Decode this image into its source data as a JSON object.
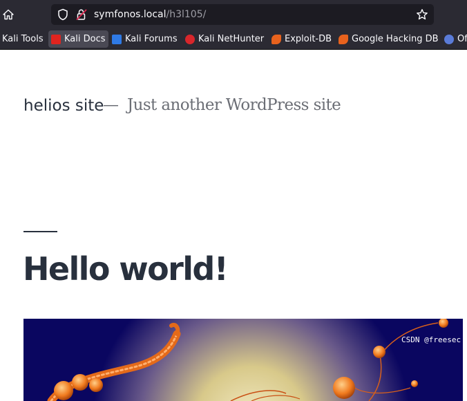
{
  "browser": {
    "url_host": "symfonos.local",
    "url_path": "/h3l105/",
    "icons": {
      "home": "home-icon",
      "shield": "shield-icon",
      "lock": "lock-strike-icon",
      "bookmark": "star-icon"
    }
  },
  "bookmarks": [
    {
      "label": "Kali Tools",
      "icon": ""
    },
    {
      "label": "Kali Docs",
      "icon": "kali-docs-icon",
      "color": "#e0241f"
    },
    {
      "label": "Kali Forums",
      "icon": "kali-forums-icon",
      "color": "#2f7ae5"
    },
    {
      "label": "Kali NetHunter",
      "icon": "kali-nethunter-icon",
      "color": "#d8262b"
    },
    {
      "label": "Exploit-DB",
      "icon": "exploit-db-icon",
      "color": "#e8621d"
    },
    {
      "label": "Google Hacking DB",
      "icon": "ghdb-icon",
      "color": "#e8621d"
    },
    {
      "label": "Of",
      "icon": "offsec-icon",
      "color": "#5a7bd8"
    }
  ],
  "site": {
    "title": "helios site",
    "separator": "—",
    "description": "Just another WordPress site"
  },
  "post": {
    "title": "Hello world!"
  },
  "watermark": "CSDN @freesec",
  "colors": {
    "toolbar_bg": "#2b2a33",
    "urlbar_bg": "#1c1b22",
    "text_dark": "#28303d",
    "image_bg": "#0a0660"
  }
}
